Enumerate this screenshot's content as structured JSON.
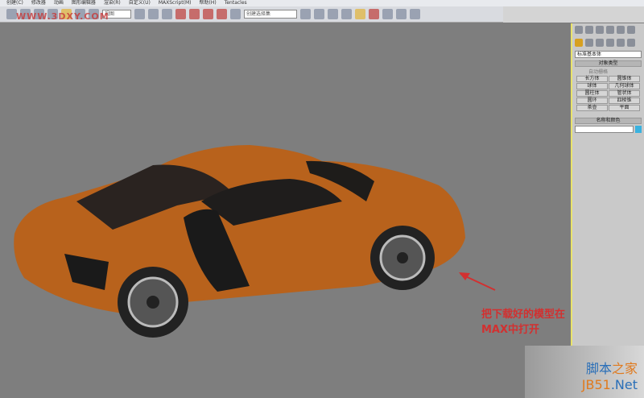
{
  "menu": [
    "创建(C)",
    "修改器",
    "动画",
    "图形编辑器",
    "渲染(R)",
    "自定义(U)",
    "MAXScript(M)",
    "帮助(H)",
    "Tentacles"
  ],
  "toolbar": {
    "view_dropdown": "视图",
    "selection_set": "创建选择集"
  },
  "watermark_top": "WWW.3DXY.COM",
  "panel": {
    "category": "标准基本体",
    "object_type_title": "对象类型",
    "autogrid": "自动栅格",
    "buttons": [
      "长方体",
      "圆锥体",
      "球体",
      "几何球体",
      "圆柱体",
      "管状体",
      "圆环",
      "四棱锥",
      "茶壶",
      "平面"
    ],
    "name_color_title": "名称和颜色"
  },
  "caption": "把下载好的模型在MAX中打开",
  "site": {
    "line1a": "脚本",
    "line1b": "之家",
    "line2a": "JB51",
    "line2b": ".Net"
  },
  "colors": {
    "car": "#b8621c",
    "viewport": "#7e7e7e",
    "caption": "#d23030"
  }
}
